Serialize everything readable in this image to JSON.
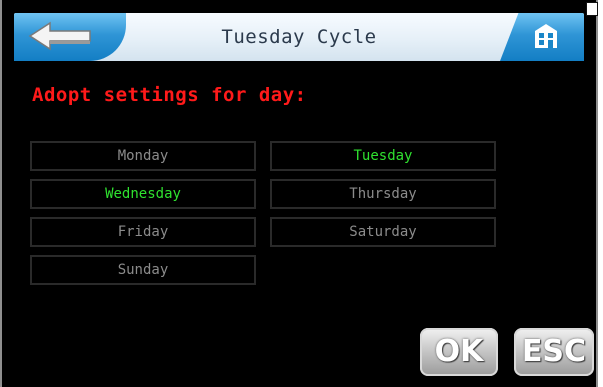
{
  "header": {
    "title": "Tuesday Cycle",
    "back_icon": "back-arrow-icon",
    "home_icon": "home-icon"
  },
  "section_title": "Adopt settings for day:",
  "days": [
    {
      "label": "Monday",
      "active": false
    },
    {
      "label": "Tuesday",
      "active": true
    },
    {
      "label": "Wednesday",
      "active": true
    },
    {
      "label": "Thursday",
      "active": false
    },
    {
      "label": "Friday",
      "active": false
    },
    {
      "label": "Saturday",
      "active": false
    },
    {
      "label": "Sunday",
      "active": false
    }
  ],
  "buttons": {
    "ok": "OK",
    "esc": "ESC"
  },
  "colors": {
    "accent_blue": "#2f95d6",
    "title_red": "#ff1a1a",
    "active_green": "#2fe12f",
    "inactive_gray": "#8b8b8b"
  }
}
